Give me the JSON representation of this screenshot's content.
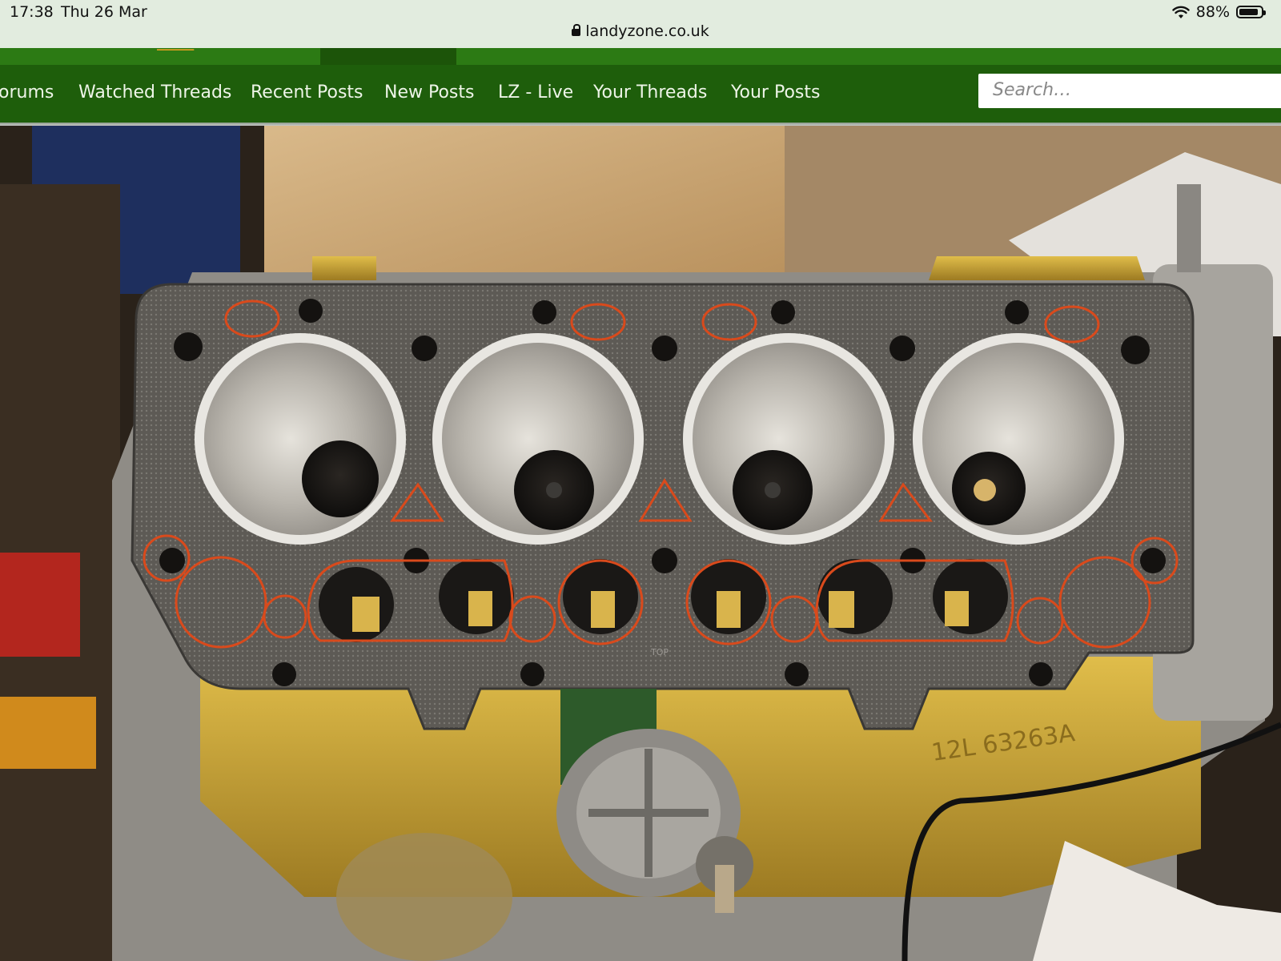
{
  "status_bar": {
    "time": "17:38",
    "date": "Thu 26 Mar",
    "battery": "88%",
    "battery_level": 0.88,
    "wifi_icon": "wifi-icon",
    "battery_icon": "battery-icon"
  },
  "browser": {
    "url": "landyzone.co.uk",
    "lock_icon": "lock-icon"
  },
  "nav": {
    "items": [
      {
        "label": "orums"
      },
      {
        "label": "Watched Threads"
      },
      {
        "label": "Recent Posts"
      },
      {
        "label": "New Posts"
      },
      {
        "label": "LZ - Live"
      },
      {
        "label": "Your Threads"
      },
      {
        "label": "Your Posts"
      }
    ],
    "search_placeholder": "Search…"
  },
  "photo": {
    "stamped_code": "12L 63263A",
    "gasket_mark": "TOP"
  },
  "colors": {
    "nav_green": "#1e5e0b",
    "top_green": "#2c7a14",
    "status_bg": "#e2ecdf",
    "gasket_outline": "#d94a1c",
    "engine_gold": "#c9a232"
  }
}
